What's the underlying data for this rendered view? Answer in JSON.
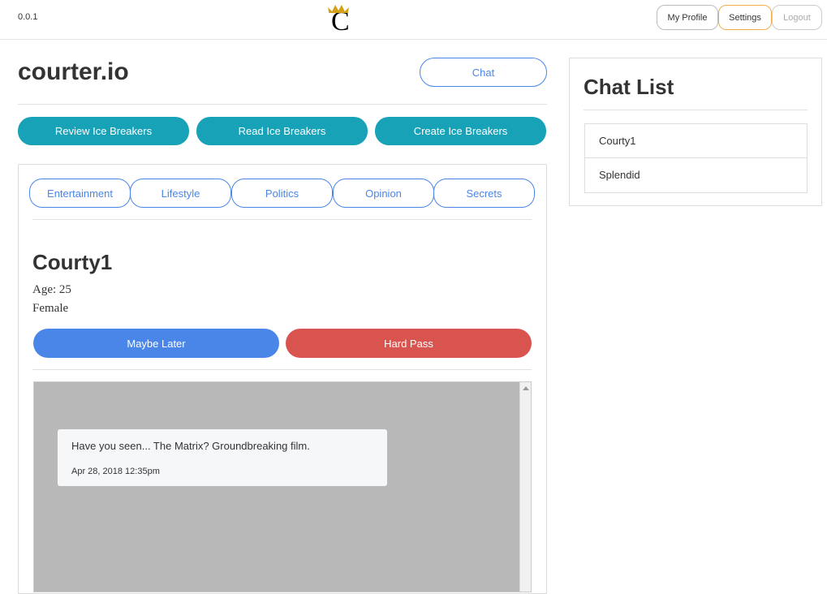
{
  "header": {
    "version": "0.0.1",
    "logo_text": "C",
    "nav": {
      "profile": "My Profile",
      "settings": "Settings",
      "logout": "Logout"
    }
  },
  "main": {
    "title": "courter.io",
    "chat_button": "Chat",
    "actions": [
      "Review Ice Breakers",
      "Read Ice Breakers",
      "Create Ice Breakers"
    ],
    "tabs": [
      "Entertainment",
      "Lifestyle",
      "Politics",
      "Opinion",
      "Secrets"
    ],
    "profile": {
      "name": "Courty1",
      "age": "Age: 25",
      "gender": "Female"
    },
    "maybe_later": "Maybe Later",
    "hard_pass": "Hard Pass",
    "message": {
      "text": "Have you seen... The Matrix? Groundbreaking film.",
      "date": "Apr 28, 2018 12:35pm"
    }
  },
  "sidebar": {
    "title": "Chat List",
    "chats": [
      "Courty1",
      "Splendid"
    ]
  },
  "colors": {
    "teal": "#17a2b8",
    "blue": "#4a86e8",
    "red": "#d9534f"
  }
}
